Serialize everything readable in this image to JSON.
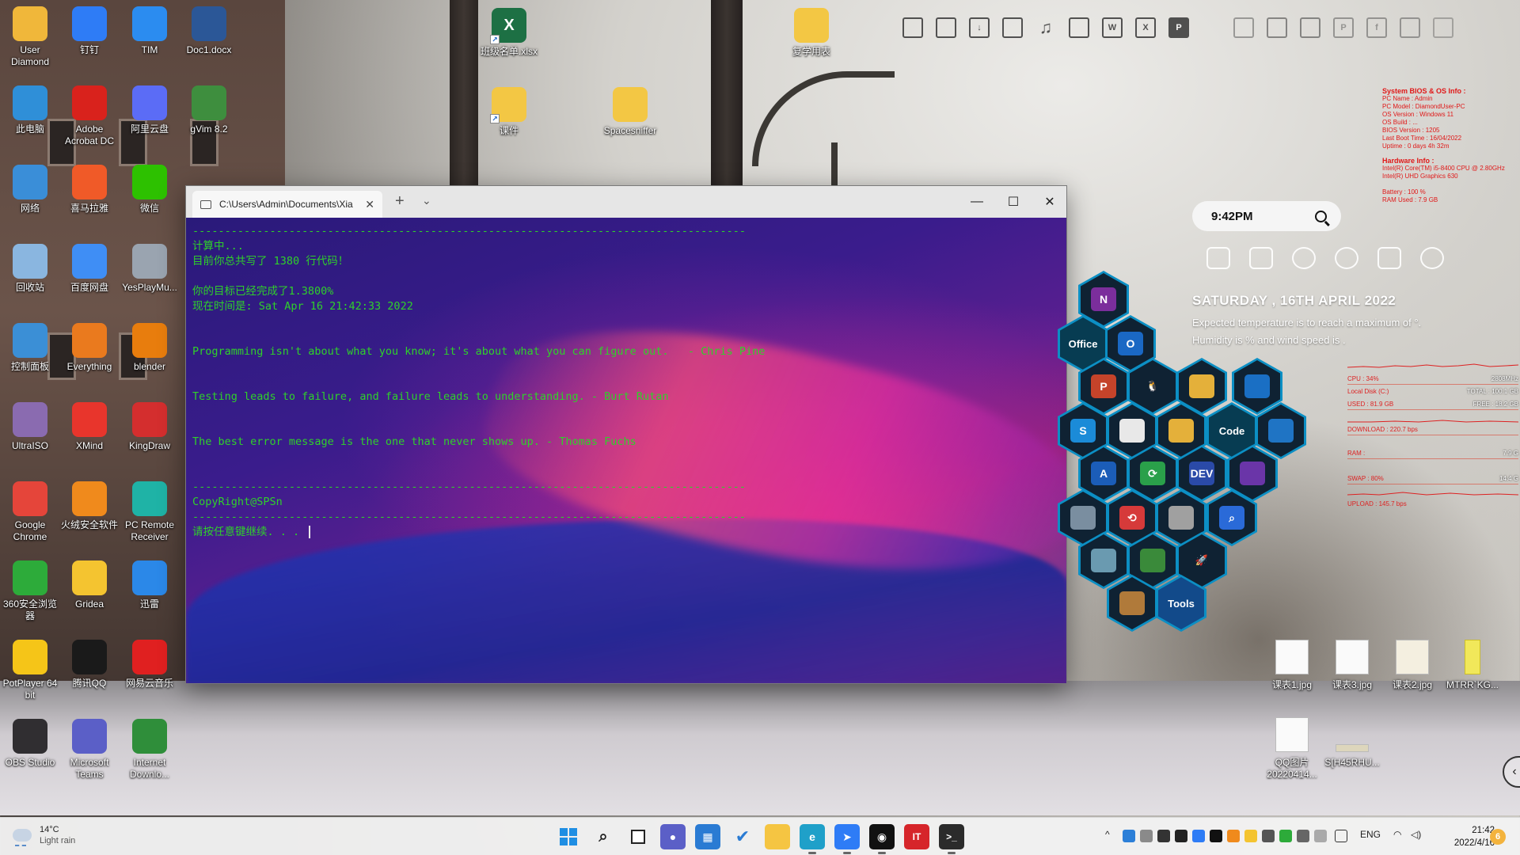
{
  "desktop_icons": [
    {
      "label": "User\nDiamond",
      "color": "#f0b73a"
    },
    {
      "label": "钉钉",
      "color": "#2e7cf6"
    },
    {
      "label": "TIM",
      "color": "#2b8cf0"
    },
    {
      "label": "Doc1.docx",
      "color": "#2b5797"
    },
    {
      "label": "此电脑",
      "color": "#2f8fd8"
    },
    {
      "label": "Adobe\nAcrobat DC",
      "color": "#d9221c"
    },
    {
      "label": "阿里云盘",
      "color": "#5b6cf6"
    },
    {
      "label": "gVim 8.2",
      "color": "#3e8e3e"
    },
    {
      "label": "网络",
      "color": "#3a8ed8"
    },
    {
      "label": "喜马拉雅",
      "color": "#f05a28"
    },
    {
      "label": "微信",
      "color": "#2dc100"
    },
    {
      "label": "回收站",
      "color": "#8ab6e0"
    },
    {
      "label": "百度网盘",
      "color": "#3f8ef5"
    },
    {
      "label": "YesPlayMu...",
      "color": "#9aa4b0"
    },
    {
      "label": "控制面板",
      "color": "#3b8fd6"
    },
    {
      "label": "Everything",
      "color": "#ea7a1e"
    },
    {
      "label": "blender",
      "color": "#e87d0d"
    },
    {
      "label": "UltraISO",
      "color": "#8a6bb0"
    },
    {
      "label": "XMind",
      "color": "#e8352c"
    },
    {
      "label": "KingDraw",
      "color": "#d42e2e"
    },
    {
      "label": "Google\nChrome",
      "color": "#e5453a"
    },
    {
      "label": "火绒安全软件",
      "color": "#f08a1c"
    },
    {
      "label": "PC Remote\nReceiver",
      "color": "#1fb3a6"
    },
    {
      "label": "360安全浏览\n器",
      "color": "#2dab3a"
    },
    {
      "label": "Gridea",
      "color": "#f4c430"
    },
    {
      "label": "迅雷",
      "color": "#2b88e8"
    },
    {
      "label": "PotPlayer 64\nbit",
      "color": "#f5c518"
    },
    {
      "label": "腾讯QQ",
      "color": "#1a1a1a"
    },
    {
      "label": "网易云音乐",
      "color": "#e02020"
    },
    {
      "label": "OBS Studio",
      "color": "#302e31"
    },
    {
      "label": "Microsoft\nTeams",
      "color": "#5b5fc7"
    },
    {
      "label": "Internet\nDownlo...",
      "color": "#2f8e3a"
    }
  ],
  "top_desktop_icons": [
    {
      "label": "班级名单.xlsx",
      "color": "#1d7044"
    },
    {
      "label": "复学用表",
      "color": "#f3c744"
    },
    {
      "label": "课件",
      "color": "#f3c744"
    },
    {
      "label": "Spacesniffer",
      "color": "#f3c744"
    }
  ],
  "terminal": {
    "tab_title": "C:\\Users\\Admin\\Documents\\Xia",
    "new_tab": "+",
    "dropdown": "⌄",
    "minimize": "—",
    "maximize": "☐",
    "close": "✕",
    "lines": [
      "--------------------------------------------------------------------------------------",
      "计算中...",
      "目前你总共写了 1380 行代码！",
      "",
      "你的目标已经完成了1.3800%",
      "现在时间是: Sat Apr 16 21:42:33 2022",
      "",
      "",
      "Programming isn't about what you know; it's about what you can figure out.   - Chris Pine",
      "",
      "",
      "Testing leads to failure, and failure leads to understanding. - Burt Rutan",
      "",
      "",
      "The best error message is the one that never shows up. - Thomas Fuchs",
      "",
      "",
      "--------------------------------------------------------------------------------------",
      "CopyRight@SPSn",
      "--------------------------------------------------------------------------------------",
      "请按任意键继续. . . "
    ]
  },
  "widget": {
    "clock_time": "9:42PM",
    "date": "SATURDAY , 16TH APRIL 2022",
    "weather1": "Expected temperature is to reach a maximum of °.",
    "weather2": "Humidity is  % and wind speed is  ."
  },
  "sys_info": {
    "header1": "System BIOS & OS Info :",
    "lines1": [
      "PC Name : Admin",
      "PC Model : DiamondUser-PC",
      "OS Version : Windows 11",
      "OS Build : ...",
      "BIOS Version : 1205",
      "Last Boot Time : 16/04/2022",
      "Uptime : 0 days 4h 32m"
    ],
    "header2": "Hardware Info :",
    "lines2": [
      "Intel(R) Core(TM) i5-8400 CPU @ 2.80GHz",
      "Intel(R) UHD Graphics 630",
      "",
      "Battery : 100 %",
      "RAM Used : 7.9 GB"
    ]
  },
  "stats": {
    "cpu_label": "CPU : 34%",
    "cpu_val": "2808MHz",
    "disk_label": "Local Disk (C:)",
    "disk_total": "TOTAL : 100.1 GB",
    "used": "USED : 81.9 GB",
    "free": "FREE : 18.2 GB",
    "download": "DOWNLOAD : 220.7 bps",
    "ram_label": "RAM :",
    "ram_val": "7.9 G",
    "swap_label": "SWAP : 80%",
    "swap_val": "14.4 G",
    "upload": "UPLOAD : 145.7 bps"
  },
  "hex_labels": {
    "office": "Office",
    "code": "Code",
    "dev": "DEV",
    "tools": "Tools"
  },
  "right_files": [
    {
      "label": "课表1.jpg"
    },
    {
      "label": "课表3.jpg"
    },
    {
      "label": "课表2.jpg"
    },
    {
      "label": "MTRR`KG..."
    },
    {
      "label": "QQ图片\n20220414..."
    },
    {
      "label": "S[H45RHU..."
    }
  ],
  "taskbar": {
    "temp": "14°C",
    "condition": "Light rain",
    "lang": "ENG",
    "time": "21:42",
    "date": "2022/4/16",
    "notif": "6"
  }
}
